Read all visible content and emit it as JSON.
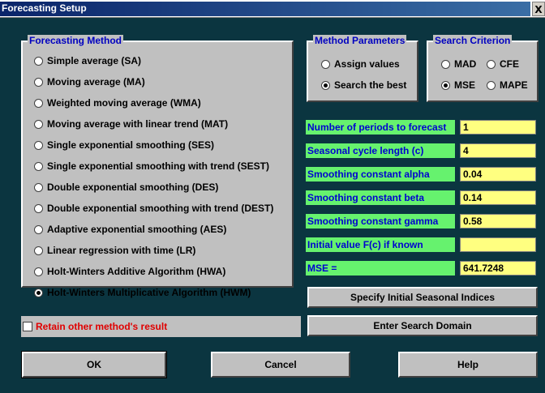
{
  "window": {
    "title": "Forecasting Setup",
    "close_glyph": "X"
  },
  "forecasting_method": {
    "legend": "Forecasting Method",
    "selected": "Holt-Winters Multiplicative Algorithm (HWM)",
    "options": [
      {
        "label": "Simple average (SA)",
        "checked": false
      },
      {
        "label": "Moving average (MA)",
        "checked": false
      },
      {
        "label": "Weighted moving average (WMA)",
        "checked": false
      },
      {
        "label": "Moving average with linear trend (MAT)",
        "checked": false
      },
      {
        "label": "Single exponential smoothing (SES)",
        "checked": false
      },
      {
        "label": "Single exponential smoothing with trend (SEST)",
        "checked": false
      },
      {
        "label": "Double exponential smoothing (DES)",
        "checked": false
      },
      {
        "label": "Double exponential smoothing with trend (DEST)",
        "checked": false
      },
      {
        "label": "Adaptive exponential smoothing (AES)",
        "checked": false
      },
      {
        "label": "Linear regression with time (LR)",
        "checked": false
      },
      {
        "label": "Holt-Winters Additive Algorithm (HWA)",
        "checked": false
      },
      {
        "label": "Holt-Winters Multiplicative Algorithm (HWM)",
        "checked": true
      }
    ]
  },
  "method_parameters": {
    "legend": "Method Parameters",
    "options": [
      {
        "label": "Assign values",
        "checked": false
      },
      {
        "label": "Search the best",
        "checked": true
      }
    ]
  },
  "search_criterion": {
    "legend": "Search Criterion",
    "options": [
      {
        "label": "MAD",
        "checked": false
      },
      {
        "label": "CFE",
        "checked": false
      },
      {
        "label": "MSE",
        "checked": true
      },
      {
        "label": "MAPE",
        "checked": false
      }
    ]
  },
  "parameters": [
    {
      "label": "Number of periods to forecast",
      "value": "1"
    },
    {
      "label": "Seasonal cycle length (c)",
      "value": "4"
    },
    {
      "label": "Smoothing constant alpha",
      "value": "0.04"
    },
    {
      "label": "Smoothing constant beta",
      "value": "0.14"
    },
    {
      "label": "Smoothing constant gamma",
      "value": "0.58"
    },
    {
      "label": "Initial value F(c) if known",
      "value": ""
    },
    {
      "label": "MSE =",
      "value": "641.7248"
    }
  ],
  "retain": {
    "label": "Retain other method's result",
    "checked": false
  },
  "buttons": {
    "specify_indices": "Specify Initial Seasonal Indices",
    "search_domain": "Enter Search Domain",
    "ok": "OK",
    "cancel": "Cancel",
    "help": "Help"
  },
  "colors": {
    "background": "#0b3540",
    "panel": "#c0c0c0",
    "legend_text": "#0000c0",
    "param_label_bg": "#66f26e",
    "param_label_text": "#0000d0",
    "param_value_bg": "#ffff80",
    "retain_text": "#e00000"
  }
}
